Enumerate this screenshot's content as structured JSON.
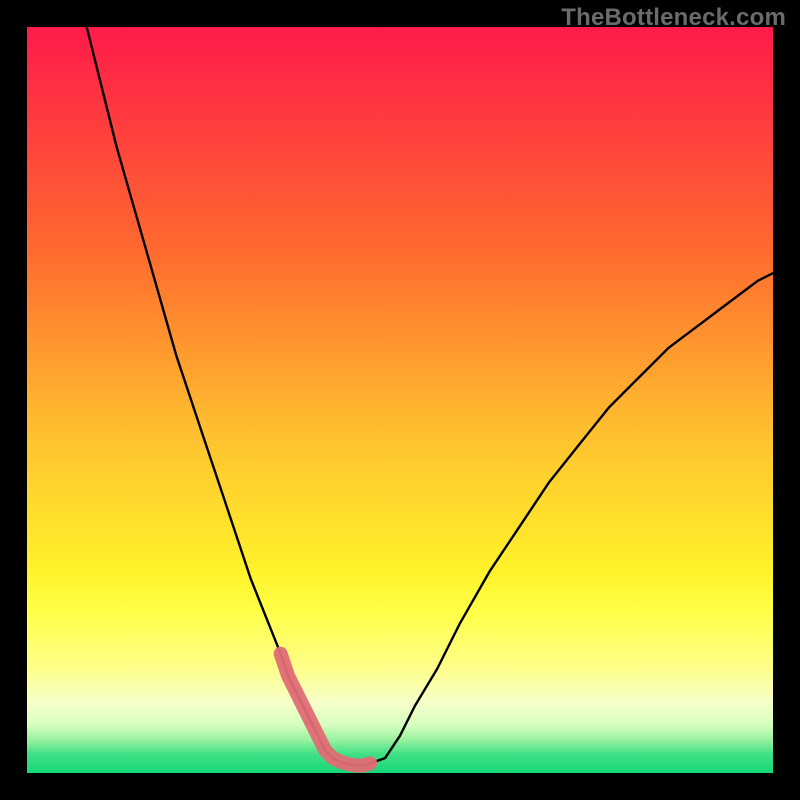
{
  "watermark": "TheBottleneck.com",
  "colors": {
    "top_gradient": "#ff1a4a",
    "mid1_gradient": "#ff7a2f",
    "mid2_gradient": "#ffd23a",
    "yellow_band": "#ffff66",
    "pale_band": "#f3ffd0",
    "green_bottom": "#15e07a",
    "curve": "#000000",
    "marker": "#e06c75",
    "frame": "#000000"
  },
  "chart_data": {
    "type": "line",
    "title": "",
    "xlabel": "",
    "ylabel": "",
    "xlim": [
      0,
      100
    ],
    "ylim": [
      0,
      100
    ],
    "x": [
      8,
      10,
      12,
      14,
      16,
      18,
      20,
      22,
      24,
      26,
      28,
      30,
      32,
      34,
      35,
      36,
      37,
      38,
      39,
      40,
      41,
      42,
      43,
      44,
      45,
      46,
      48,
      50,
      52,
      55,
      58,
      62,
      66,
      70,
      74,
      78,
      82,
      86,
      90,
      94,
      98,
      100
    ],
    "series": [
      {
        "name": "bottleneck-curve",
        "values": [
          100,
          92,
          84,
          77,
          70,
          63,
          56,
          50,
          44,
          38,
          32,
          26,
          21,
          16,
          13,
          11,
          9,
          7,
          5,
          3,
          2,
          1.5,
          1.2,
          1,
          1,
          1.3,
          2,
          5,
          9,
          14,
          20,
          27,
          33,
          39,
          44,
          49,
          53,
          57,
          60,
          63,
          66,
          67
        ]
      }
    ],
    "highlight_segment": {
      "x_start": 34,
      "x_end": 47,
      "description": "thick-pink-valley-marker"
    },
    "legend": [],
    "annotations": []
  }
}
